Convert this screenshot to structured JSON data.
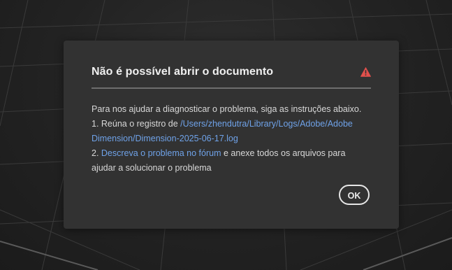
{
  "dialog": {
    "title": "Não é possível abrir o documento",
    "icon": "alert-triangle-icon",
    "icon_color": "#e2504c",
    "line1": "Para nos ajudar a diagnosticar o problema, siga as instruções abaixo.",
    "line2_prefix": "1. Reúna o registro de ",
    "log_path_part1": "/Users/zhendutra/Library/Logs/Adobe/Adobe",
    "log_path_part2": "Dimension/Dimension-2025-06-17.log",
    "line4_prefix": "2. ",
    "forum_link": "Descreva o problema no fórum",
    "line4_suffix": " e anexe todos os arquivos para",
    "line5": "ajudar a solucionar o problema",
    "ok_label": "OK",
    "link_color": "#6fa2e8"
  }
}
